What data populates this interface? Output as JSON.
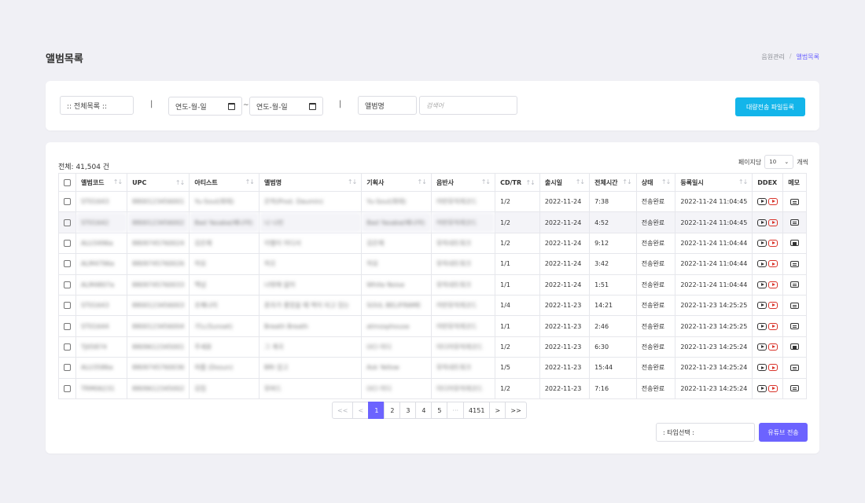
{
  "page": {
    "title": "앨범목록",
    "breadcrumb": [
      "음원관리",
      "앨범목록"
    ]
  },
  "filters": {
    "list_select": ":: 전체목록 ::",
    "divider": "|",
    "date_from_placeholder": "연도-월-일",
    "tilde": "~",
    "date_to_placeholder": "연도-월-일",
    "keyword_select": "앨범명",
    "search_placeholder": "검색어",
    "bulk_button": "대량전송 파일등록"
  },
  "list": {
    "total_text": "전체: 41,504 건",
    "perpage_label": "페이지당",
    "perpage_value": "10",
    "perpage_unit": "개씩",
    "columns": [
      "앨범코드",
      "UPC",
      "아티스트",
      "앨범명",
      "기획사",
      "음반사",
      "CD/TR",
      "출시일",
      "전체시간",
      "상태",
      "등록일시",
      "DDEX",
      "메모"
    ],
    "rows": [
      [
        "ST01643",
        "8800123456001",
        "Yu-Soul(최태)",
        "은하(Prod. Daumin)",
        "Yu-Soul(최태)",
        "어반뮤직레코드",
        "1/2",
        "2022-11-24",
        "7:38",
        "전송완료",
        "2022-11-24 11:04:45"
      ],
      [
        "ST01642",
        "8800123456002",
        "Bad Yasaba(배나야)",
        "나 나린",
        "Bad Yasaba(배나야)",
        "어반뮤직레코드",
        "1/2",
        "2022-11-24",
        "4:52",
        "전송완료",
        "2022-11-24 11:04:45"
      ],
      [
        "ALU3496a",
        "8809745760024",
        "김은채",
        "이별이 어디서",
        "김은채",
        "뮤직네트워크",
        "1/2",
        "2022-11-24",
        "9:12",
        "전송완료",
        "2022-11-24 11:04:44"
      ],
      [
        "ALM4796a",
        "8809745760026",
        "하요",
        "하오",
        "하요",
        "뮤직네트워크",
        "1/1",
        "2022-11-24",
        "3:42",
        "전송완료",
        "2022-11-24 11:04:44"
      ],
      [
        "ALM4807a",
        "8809745760033",
        "핵넘",
        "너밖에 없어",
        "White Noise",
        "뮤직네트워크",
        "1/1",
        "2022-11-24",
        "1:51",
        "전송완료",
        "2022-11-24 11:04:44"
      ],
      [
        "ST01643",
        "8800123456003",
        "조혜나미",
        "혼자가 좋았을 때 짝이 되고 있는",
        "SOUL BELIFRAME",
        "어반뮤직레코드",
        "1/4",
        "2022-11-23",
        "14:21",
        "전송완료",
        "2022-11-23 14:25:25"
      ],
      [
        "ST01644",
        "8800123456004",
        "가노(Sunset)",
        "Breath Breath",
        "atmosphouse",
        "어반뮤직레코드",
        "1/1",
        "2022-11-23",
        "2:46",
        "전송완료",
        "2022-11-23 14:25:25"
      ],
      [
        "TJ05874",
        "8809612345001",
        "주세윤",
        "그 계곡",
        "OCI 미디",
        "미디어뮤직레코드",
        "1/2",
        "2022-11-23",
        "6:30",
        "전송완료",
        "2022-11-23 14:25:24"
      ],
      [
        "ALU3586a",
        "8809745760036",
        "외롭 (Dosun)",
        "BRI 잡고",
        "Ask Yellow",
        "뮤직네트워크",
        "1/5",
        "2022-11-23",
        "15:44",
        "전송완료",
        "2022-11-23 14:25:24"
      ],
      [
        "TRM06231",
        "8809612345002",
        "김임",
        "뮤바드",
        "OCI 미디",
        "미디어뮤직레코드",
        "1/2",
        "2022-11-23",
        "7:16",
        "전송완료",
        "2022-11-23 14:25:24"
      ]
    ]
  },
  "pagination": {
    "first": "<<",
    "prev": "<",
    "pages": [
      "1",
      "2",
      "3",
      "4",
      "5",
      "···",
      "4151"
    ],
    "active": "1",
    "next": ">",
    "last": ">>"
  },
  "footer": {
    "type_select": ": 타입선택 :",
    "youtube_button": "유튜브 전송"
  },
  "colors": {
    "accent": "#6c63ff",
    "bulk_button": "#13b5ea",
    "ddex_red": "#d9342b"
  }
}
